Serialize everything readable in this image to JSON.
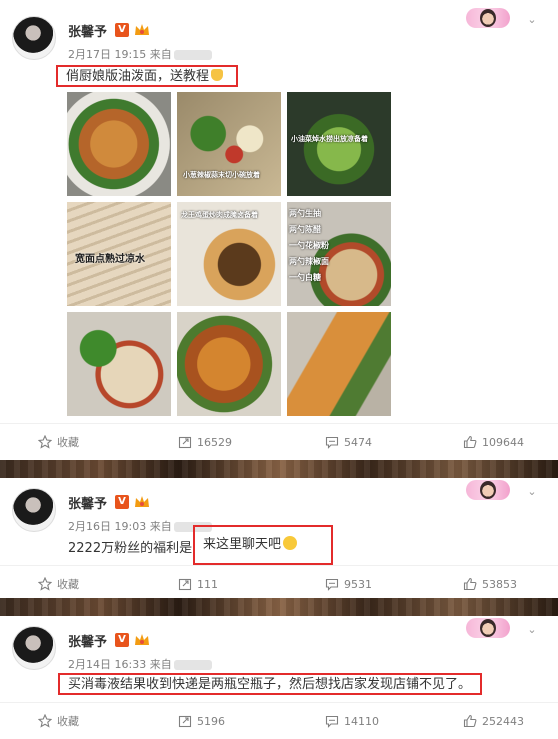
{
  "posts": [
    {
      "username": "张馨予",
      "date": "2月17日 19:15",
      "source_prefix": "来自",
      "text": "俏厨娘版油泼面，送教程",
      "photo_captions": [
        "",
        "小葱辣椒蒜末切小碗放着",
        "小油菜焯水捞出放凉备着",
        "宽面点熟过凉水",
        "龙王鸡蛋炒肉成腌卤备着",
        "两勺生抽\n两勺陈醋\n一勺花椒粉\n两勺辣椒面\n一勺白糖",
        "",
        "",
        ""
      ],
      "actions": {
        "favorite": "收藏",
        "repost": "16529",
        "comment": "5474",
        "like": "109644"
      }
    },
    {
      "username": "张馨予",
      "date": "2月16日 19:03",
      "source_prefix": "来自",
      "text_prefix": "2222万粉丝的福利是",
      "text_highlight": "来这里聊天吧",
      "actions": {
        "favorite": "收藏",
        "repost": "111",
        "comment": "9531",
        "like": "53853"
      }
    },
    {
      "username": "张馨予",
      "date": "2月14日 16:33",
      "source_prefix": "来自",
      "text": "买消毒液结果收到快递是两瓶空瓶子，然后想找店家发现店铺不见了。",
      "actions": {
        "favorite": "收藏",
        "repost": "5196",
        "comment": "14110",
        "like": "252443"
      }
    }
  ],
  "colors": {
    "highlight_border": "#e32b2b",
    "verified_badge": "#e8541c",
    "meta_text": "#808080"
  },
  "icons": {
    "verified": "V",
    "expand": "chevron-down-icon"
  }
}
